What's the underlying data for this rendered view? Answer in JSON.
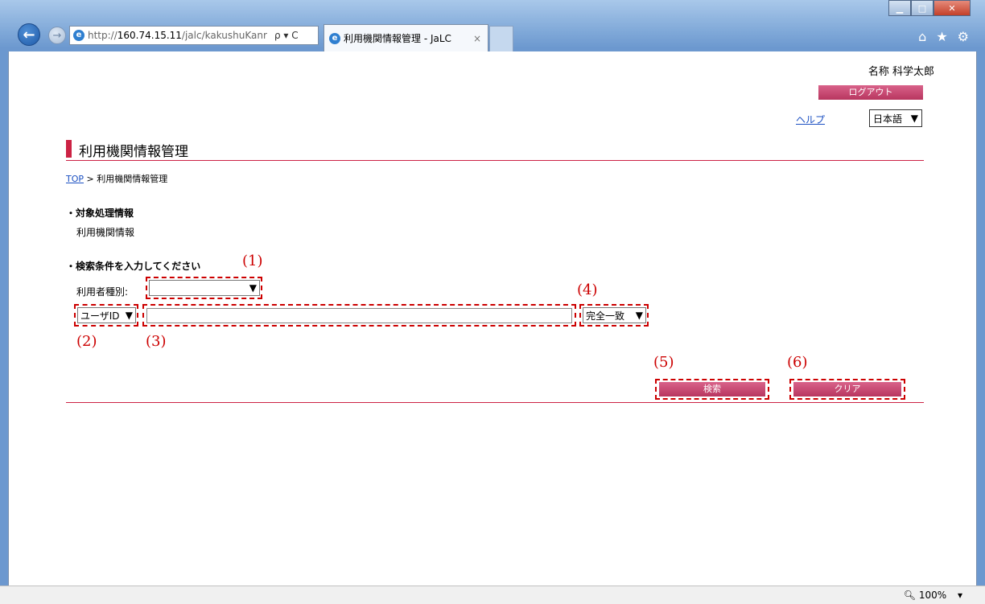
{
  "browser": {
    "url_prefix": "http://",
    "url_host": "160.74.15.11",
    "url_path": "/jalc/kakushuKanr",
    "address_icons": "ρ ▾ C",
    "tab_title": "利用機関情報管理 - JaLC",
    "tab_close": "×",
    "zoom": "100%",
    "zoom_arrow": "▾"
  },
  "header": {
    "user_name": "名称 科学太郎",
    "logout_label": "ログアウト",
    "help_label": "ヘルプ",
    "language": "日本語"
  },
  "page": {
    "title": "利用機関情報管理",
    "breadcrumb_top": "TOP",
    "breadcrumb_sep": " > ",
    "breadcrumb_current": "利用機関情報管理"
  },
  "target_section": {
    "heading": "・対象処理情報",
    "value": "利用機関情報"
  },
  "search_section": {
    "heading": "・検索条件を入力してください",
    "user_type_label": "利用者種別:",
    "user_type_value": "",
    "field_select_value": "ユーザID",
    "keyword_value": "",
    "match_select_value": "完全一致",
    "search_label": "検索",
    "clear_label": "クリア"
  },
  "callouts": {
    "c1": "(1)",
    "c2": "(2)",
    "c3": "(3)",
    "c4": "(4)",
    "c5": "(5)",
    "c6": "(6)"
  }
}
